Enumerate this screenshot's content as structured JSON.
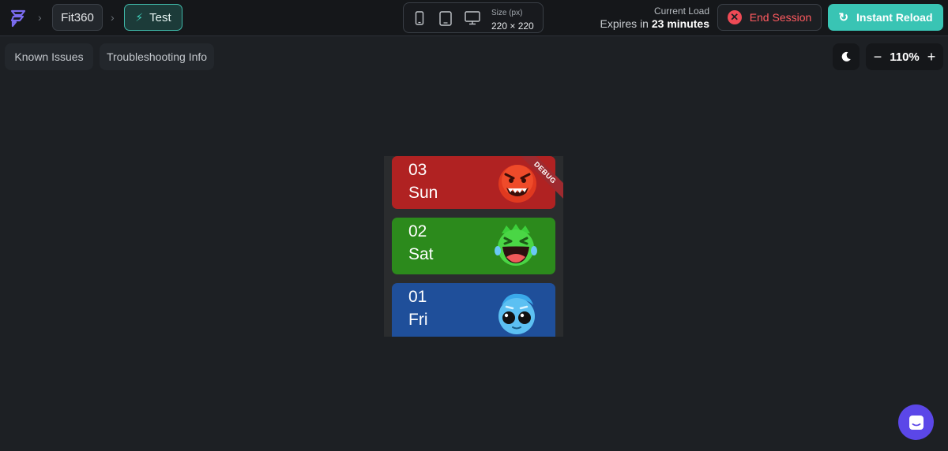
{
  "header": {
    "project": "Fit360",
    "mode": "Test",
    "size_label": "Size (px)",
    "size_value": "220 × 220",
    "load_label": "Current Load",
    "expires_prefix": "Expires in",
    "expires_value": "23 minutes",
    "end_session": "End Session",
    "instant_reload": "Instant Reload"
  },
  "toolbar": {
    "known_issues": "Known Issues",
    "troubleshooting": "Troubleshooting Info",
    "zoom": "110%",
    "zoom_out_symbol": "−",
    "zoom_in_symbol": "+"
  },
  "preview": {
    "debug_banner": "DEBUG",
    "cards": [
      {
        "num": "03",
        "day": "Sun",
        "color": "#b02222",
        "emoji": "angry-monster-icon"
      },
      {
        "num": "02",
        "day": "Sat",
        "color": "#2c8a1c",
        "emoji": "laughing-monster-icon"
      },
      {
        "num": "01",
        "day": "Fri",
        "color": "#1f4f9a",
        "emoji": "cool-monster-icon"
      }
    ]
  },
  "colors": {
    "accent": "#39c4b4",
    "danger": "#ef4a55",
    "chat": "#5b47e8"
  }
}
